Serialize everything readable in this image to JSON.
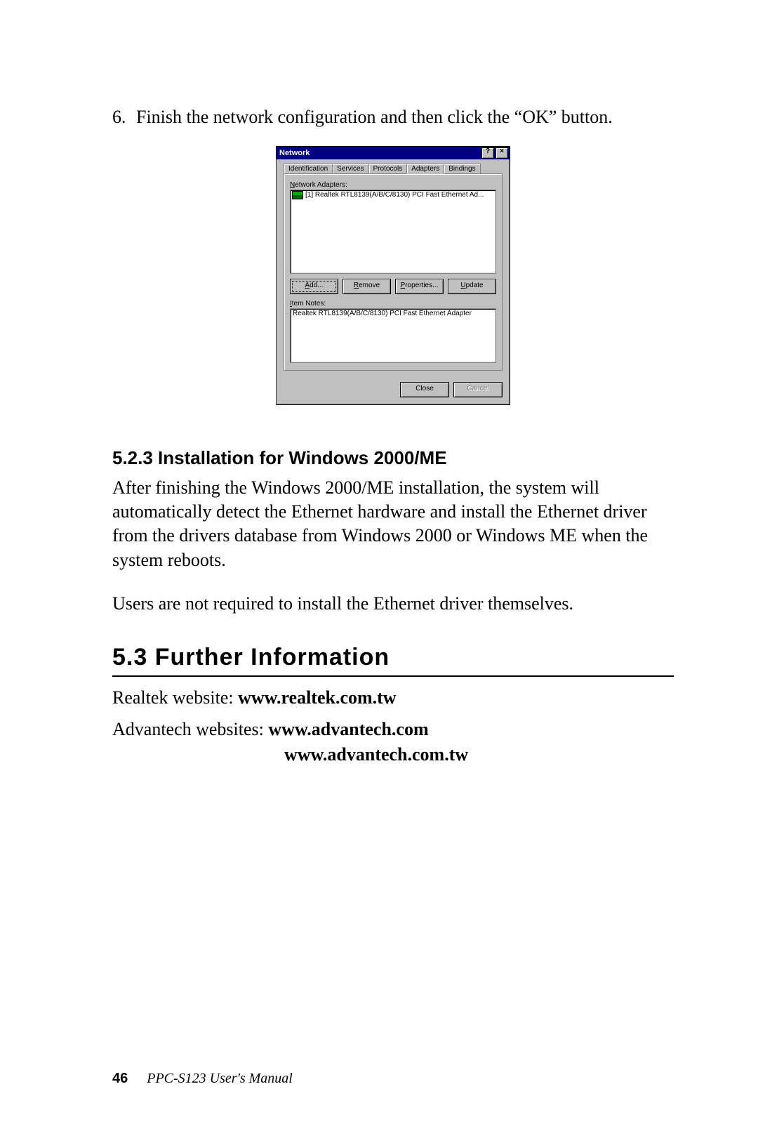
{
  "step": {
    "number": "6.",
    "text": "Finish the network configuration and then click the “OK” button."
  },
  "dialog": {
    "title": "Network",
    "help_btn": "?",
    "close_btn": "×",
    "tabs": [
      "Identification",
      "Services",
      "Protocols",
      "Adapters",
      "Bindings"
    ],
    "active_tab_index": 3,
    "adapters_label": "Network Adapters:",
    "adapter_item": "[1] Realtek RTL8139(A/B/C/8130) PCI Fast Ethernet Ad...",
    "buttons": {
      "add": "Add...",
      "remove": "Remove",
      "properties": "Properties...",
      "update": "Update"
    },
    "item_notes_label": "Item Notes:",
    "item_notes_text": "Realtek RTL8139(A/B/C/8130) PCI Fast Ethernet Adapter",
    "footer": {
      "close": "Close",
      "cancel": "Cancel"
    }
  },
  "subsection": {
    "heading": "5.2.3 Installation for Windows 2000/ME",
    "p1": "After finishing the Windows 2000/ME installation, the system will automatically detect the Ethernet hardware and install the Ethernet driver from the drivers database from Windows 2000 or Windows ME when the system reboots.",
    "p2": "Users are not required to install the Ethernet driver themselves."
  },
  "section": {
    "heading": "5.3  Further Information",
    "realtek_label": "Realtek website: ",
    "realtek_url": "www.realtek.com.tw",
    "advantech_label": "Advantech websites: ",
    "advantech_url1": "www.advantech.com",
    "advantech_url2": "www.advantech.com.tw"
  },
  "footer": {
    "page": "46",
    "title": "PPC-S123  User's Manual"
  }
}
